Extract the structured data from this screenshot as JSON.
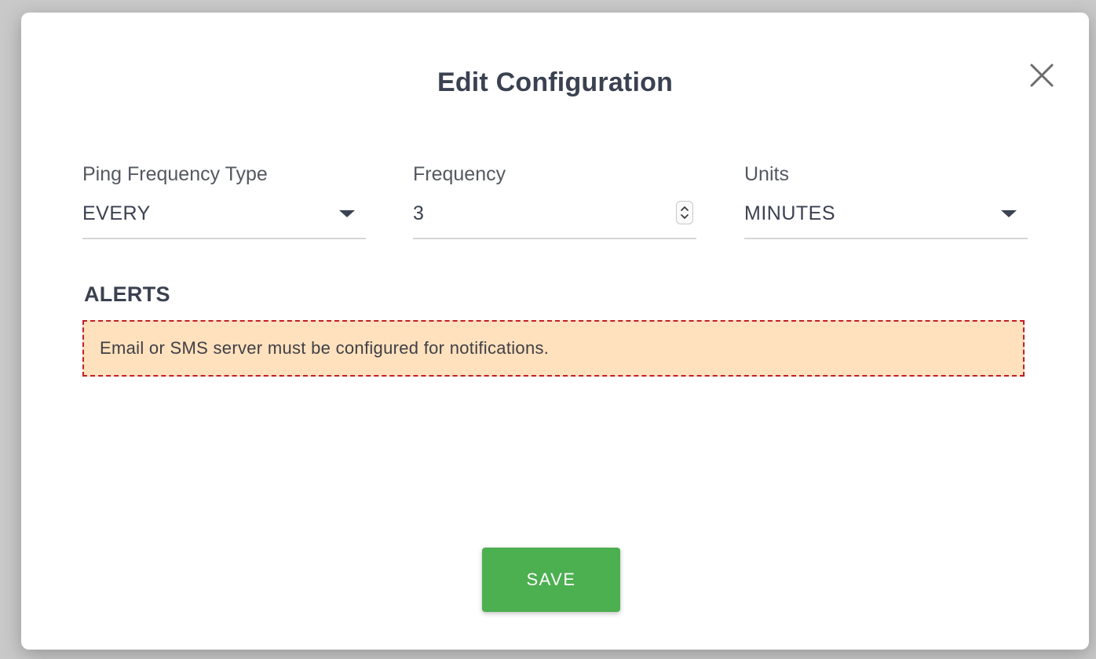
{
  "dialog": {
    "title": "Edit Configuration",
    "close_icon": "close-icon"
  },
  "fields": {
    "ping_frequency_type": {
      "label": "Ping Frequency Type",
      "value": "EVERY",
      "icon": "caret-down-icon"
    },
    "frequency": {
      "label": "Frequency",
      "value": "3",
      "icon": "number-spinner-icon"
    },
    "units": {
      "label": "Units",
      "value": "MINUTES",
      "icon": "caret-down-icon"
    }
  },
  "alerts": {
    "heading": "ALERTS",
    "message": "Email or SMS server must be configured for notifications.",
    "background_color": "#ffe1bd",
    "border_color": "#c0202a"
  },
  "actions": {
    "save_label": "SAVE",
    "save_color": "#4caf50"
  }
}
